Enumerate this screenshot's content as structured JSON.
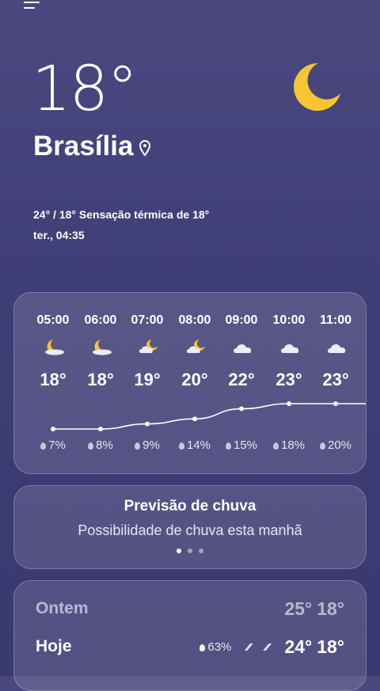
{
  "header": {
    "temperature": "18°",
    "city": "Brasília",
    "high_low_feels": "24° / 18° Sensação térmica de 18°",
    "datetime": "ter., 04:35"
  },
  "hourly": [
    {
      "time": "05:00",
      "icon": "moon-icon",
      "temp": "18°",
      "rain": "7%",
      "temp_value": 18
    },
    {
      "time": "06:00",
      "icon": "moon-icon",
      "temp": "18°",
      "rain": "8%",
      "temp_value": 18
    },
    {
      "time": "07:00",
      "icon": "partly-cloudy-icon",
      "temp": "19°",
      "rain": "9%",
      "temp_value": 19
    },
    {
      "time": "08:00",
      "icon": "partly-cloudy-icon",
      "temp": "20°",
      "rain": "14%",
      "temp_value": 20
    },
    {
      "time": "09:00",
      "icon": "cloud-icon",
      "temp": "22°",
      "rain": "15%",
      "temp_value": 22
    },
    {
      "time": "10:00",
      "icon": "cloud-icon",
      "temp": "23°",
      "rain": "18%",
      "temp_value": 23
    },
    {
      "time": "11:00",
      "icon": "cloud-icon",
      "temp": "23°",
      "rain": "20%",
      "temp_value": 23
    }
  ],
  "rain_forecast": {
    "title": "Previsão de chuva",
    "subtitle": "Possibilidade de chuva esta manhã"
  },
  "daily": {
    "yesterday": {
      "label": "Ontem",
      "high": "25°",
      "low": "18°"
    },
    "today": {
      "label": "Hoje",
      "rain": "63%",
      "high": "24°",
      "low": "18°"
    }
  },
  "colors": {
    "background": "#433f7a",
    "moon": "#f6c631",
    "cloud": "#ebeef5"
  }
}
